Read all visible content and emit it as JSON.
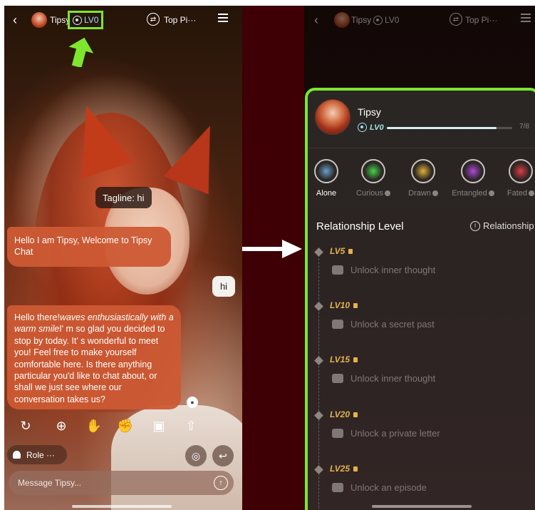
{
  "left": {
    "header": {
      "name": "Tipsy",
      "level": "LV0",
      "mode": "Top Pi···"
    },
    "tagline": "Tagline: hi",
    "messages": [
      {
        "role": "assistant",
        "text": "Hello I am Tipsy, Welcome to Tipsy Chat"
      },
      {
        "role": "user",
        "text": "hi"
      },
      {
        "role": "assistant",
        "text_parts": {
          "italic": "waves enthusiastically with a warm smile",
          "before": "Hello there!",
          "after": "I' m so glad you decided to stop by today. It' s wonderful to meet you! Feel free to make yourself comfortable here. Is there anything particular you'd like to chat about, or shall we just see where our conversation takes us?"
        }
      }
    ],
    "action_icons": [
      "regenerate-icon",
      "continue-icon",
      "thumbs-up-icon",
      "thumbs-down-icon",
      "add-image-icon",
      "share-icon"
    ],
    "role_label": "Role ···",
    "input_placeholder": "Message Tipsy..."
  },
  "right": {
    "header": {
      "name": "Tipsy",
      "level": "LV0",
      "mode": "Top Pi···"
    },
    "profile": {
      "name": "Tipsy",
      "level": "LV0",
      "progress": "7/8",
      "progress_fraction": 0.875
    },
    "stages": [
      {
        "label": "Alone",
        "active": true,
        "color": "#6fa0c8"
      },
      {
        "label": "Curious",
        "active": false,
        "color": "#4bd34b"
      },
      {
        "label": "Drawn",
        "active": false,
        "color": "#e0b03a"
      },
      {
        "label": "Entangled",
        "active": false,
        "color": "#b24bd6"
      },
      {
        "label": "Fated",
        "active": false,
        "color": "#e0404a"
      }
    ],
    "relationship_title": "Relationship Level",
    "relationship_link": "Relationship",
    "levels": [
      {
        "name": "LV5",
        "reward": "Unlock inner thought"
      },
      {
        "name": "LV10",
        "reward": "Unlock a secret past"
      },
      {
        "name": "LV15",
        "reward": "Unlock inner thought"
      },
      {
        "name": "LV20",
        "reward": "Unlock a private letter"
      },
      {
        "name": "LV25",
        "reward": "Unlock an episode"
      }
    ]
  },
  "colors": {
    "highlight": "#7ee62e",
    "bubble": "#cc5a34",
    "level_gold": "#e3b24f"
  }
}
